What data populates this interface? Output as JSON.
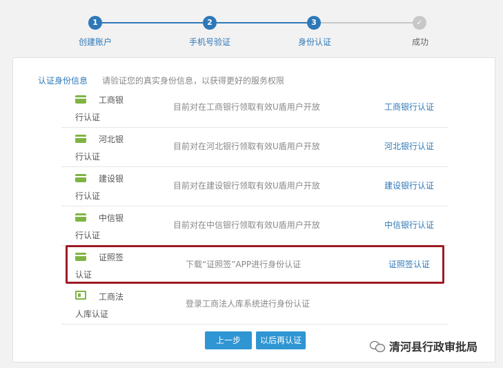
{
  "steps": [
    {
      "number": "1",
      "label": "创建账户"
    },
    {
      "number": "2",
      "label": "手机号验证"
    },
    {
      "number": "3",
      "label": "身份认证"
    },
    {
      "number": "✓",
      "label": "成功"
    }
  ],
  "info": {
    "title": "认证身份信息",
    "description": "请验证您的真实身份信息，以获得更好的服务权限"
  },
  "rows": [
    {
      "name": "工商银行认证",
      "icon": "bank-card-icon",
      "desc": "目前对在工商银行领取有效U盾用户开放",
      "action": "工商银行认证"
    },
    {
      "name": "河北银行认证",
      "icon": "bank-card-icon",
      "desc": "目前对在河北银行领取有效U盾用户开放",
      "action": "河北银行认证"
    },
    {
      "name": "建设银行认证",
      "icon": "bank-card-icon",
      "desc": "目前对在建设银行领取有效U盾用户开放",
      "action": "建设银行认证"
    },
    {
      "name": "中信银行认证",
      "icon": "bank-card-icon",
      "desc": "目前对在中信银行领取有效U盾用户开放",
      "action": "中信银行认证"
    },
    {
      "name": "证照签认证",
      "icon": "bank-card-icon",
      "desc": "下载“证照签”APP进行身份认证",
      "action": "证照签认证"
    },
    {
      "name": "工商法人库认证",
      "icon": "id-card-icon",
      "desc": "登录工商法人库系统进行身份认证",
      "action": ""
    }
  ],
  "buttons": {
    "prev": "上一步",
    "later": "以后再认证"
  },
  "watermark": "清河县行政审批局",
  "colors": {
    "accent": "#2e78b8",
    "button": "#2f95d3",
    "highlight": "#9d1a24",
    "icon_green": "#7fb443",
    "inactive": "#c8c8c8"
  }
}
